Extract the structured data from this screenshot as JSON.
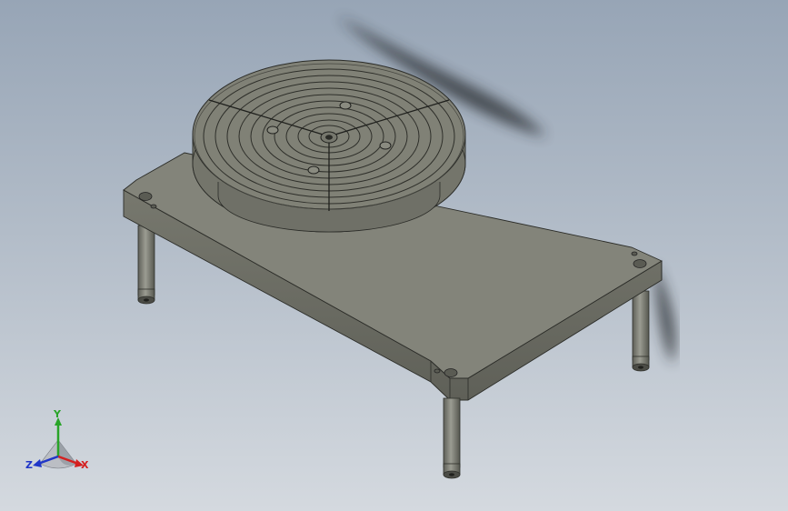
{
  "viewport": {
    "background_top": "#97a5b6",
    "background_bottom": "#d4d9df"
  },
  "model": {
    "plate_top_color": "#83847a",
    "plate_side_color": "#6c6d64",
    "turntable_color": "#808176",
    "turntable_groove_color": "#2e2f2a",
    "leg_color": "#7a7b72",
    "hole_color": "#55564f"
  },
  "triad": {
    "x_label": "X",
    "y_label": "Y",
    "z_label": "Z",
    "x_color": "#d42020",
    "y_color": "#28a428",
    "z_color": "#2036c8"
  }
}
